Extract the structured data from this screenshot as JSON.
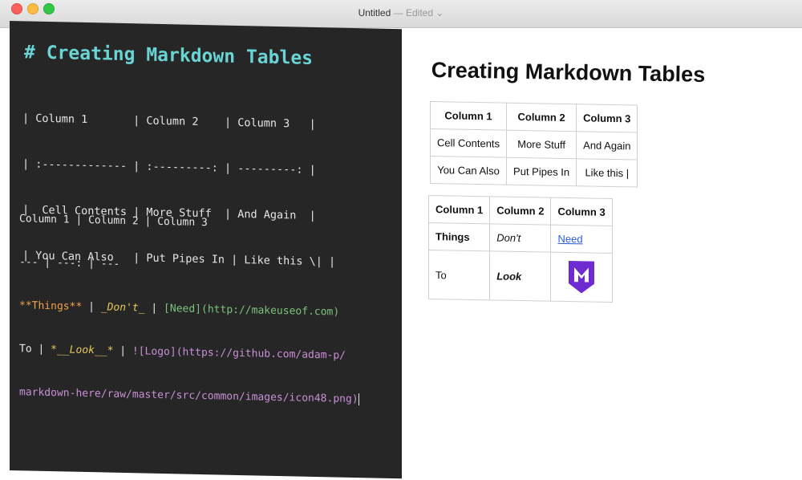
{
  "window": {
    "title": "Untitled",
    "edited_label": "Edited",
    "chevron": "⌄"
  },
  "editor": {
    "heading": "# Creating Markdown Tables",
    "md_table_lines": [
      "| Column 1       | Column 2    | Column 3   |",
      "| :------------- | :---------: | ---------: |",
      "|  Cell Contents | More Stuff  | And Again  |",
      "| You Can Also   | Put Pipes In | Like this \\| |"
    ],
    "line_header": "Column 1 | Column 2 | Column 3",
    "line_sep": "--- | ---: | ---",
    "row1": {
      "things": "**Things**",
      "pipe": " | ",
      "dont": "_Don't_",
      "pipe2": " | ",
      "need": "[Need](http://makeuseof.com)"
    },
    "row2": {
      "to": "To",
      "pipe": " | ",
      "look": "*__Look__*",
      "pipe2": " | ",
      "img_a": "![Logo](https://github.com/adam-p/",
      "img_b": "markdown-here/raw/master/src/common/images/icon48.png)"
    }
  },
  "preview": {
    "title": "Creating Markdown Tables",
    "table1": {
      "headers": [
        "Column 1",
        "Column 2",
        "Column 3"
      ],
      "rows": [
        [
          "Cell Contents",
          "More Stuff",
          "And Again"
        ],
        [
          "You Can Also",
          "Put Pipes In",
          "Like this |"
        ]
      ]
    },
    "table2": {
      "headers": [
        "Column 1",
        "Column 2",
        "Column 3"
      ],
      "row1": {
        "c1": "Things",
        "c2": "Don't",
        "c3": "Need"
      },
      "row2": {
        "c1": "To",
        "c2": "Look",
        "c3_icon": "makeuseof-logo-icon"
      }
    },
    "colors": {
      "logo": "#6e2bd1",
      "link": "#2a5bd7"
    }
  }
}
